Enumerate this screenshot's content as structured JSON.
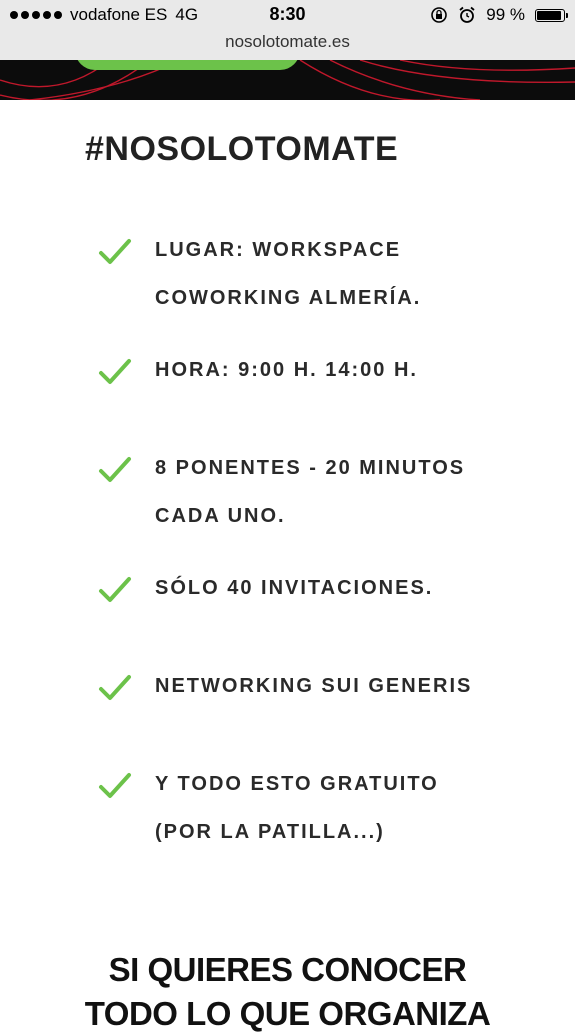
{
  "status_bar": {
    "carrier": "vodafone ES",
    "network": "4G",
    "time": "8:30",
    "battery": "99 %",
    "battery_level": 0.99
  },
  "url_bar": {
    "url": "nosolotomate.es"
  },
  "colors": {
    "accent_green": "#6cc24a",
    "hero_bg": "#0c0c0c",
    "hero_lines": "#c0182b"
  },
  "content": {
    "title": "#NOSOLOTOMATE",
    "items": [
      {
        "lines": [
          "LUGAR: WORKSPACE",
          "COWORKING ALMERÍA."
        ]
      },
      {
        "lines": [
          "HORA: 9:00 H. 14:00 H."
        ]
      },
      {
        "lines": [
          "8 PONENTES - 20 MINUTOS",
          "CADA UNO."
        ]
      },
      {
        "lines": [
          "SÓLO 40 INVITACIONES."
        ]
      },
      {
        "lines": [
          "NETWORKING SUI GENERIS"
        ]
      },
      {
        "lines": [
          "Y TODO ESTO GRATUITO",
          "(POR LA PATILLA...)"
        ]
      }
    ],
    "cta_lines": [
      "SI QUIERES CONOCER",
      "TODO LO QUE ORGANIZA"
    ]
  }
}
